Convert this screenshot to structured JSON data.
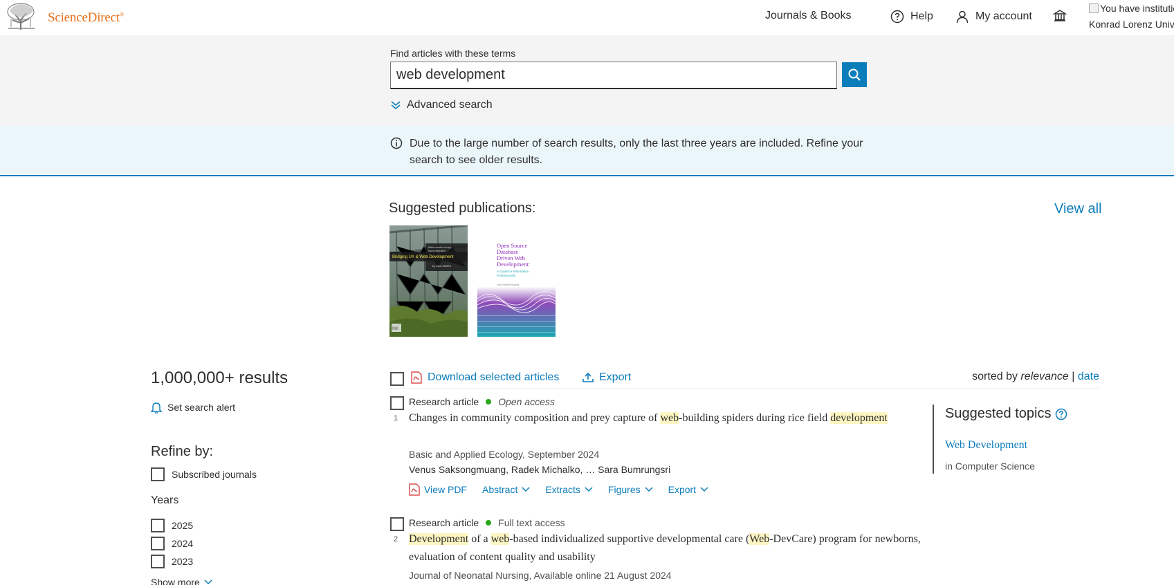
{
  "header": {
    "brand": "ScienceDirect",
    "brand_mark": "®",
    "nav_journals": "Journals & Books",
    "nav_help": "Help",
    "nav_account": "My account",
    "institution_alt": "You have institutional access",
    "institution_name": "Konrad Lorenz University"
  },
  "search": {
    "label": "Find articles with these terms",
    "value": "web development",
    "advanced": "Advanced search"
  },
  "notice": {
    "text": "Due to the large number of search results, only the last three years are included. Refine your search to see older results."
  },
  "suggested_publications": {
    "title": "Suggested publications:",
    "view_all": "View all",
    "books": [
      {
        "title": "Bridging UX & Web Development",
        "line1": "Better results through",
        "line2": "team integration",
        "author": "by Jack Moffett",
        "publisher": "MK"
      },
      {
        "title_lines": [
          "Open Source",
          "Database",
          "Driven Web",
          "Development:"
        ],
        "subtitle_lines": [
          "A Guide for Information",
          "Professionals"
        ],
        "author": "Jason Bartlett Reading"
      }
    ]
  },
  "sidebar": {
    "results_count": "1,000,000+ results",
    "set_alert": "Set search alert",
    "refine_title": "Refine by:",
    "subscribed": "Subscribed journals",
    "years_title": "Years",
    "years": [
      "2025",
      "2024",
      "2023"
    ],
    "show_more": "Show more"
  },
  "toolbar": {
    "download": "Download selected articles",
    "export": "Export",
    "sorted_prefix": "sorted by",
    "sorted_current": "relevance",
    "sorted_sep": "|",
    "sorted_alt": "date"
  },
  "results": [
    {
      "num": "1",
      "type": "Research article",
      "access": "Open access",
      "title_parts": [
        "Changes in community composition and prey capture of ",
        "web",
        "-building spiders during rice field ",
        "development"
      ],
      "source": "Basic and Applied Ecology, September 2024",
      "authors": "Venus Saksongmuang, Radek Michalko, … Sara Bumrungsri",
      "actions": [
        "View PDF",
        "Abstract",
        "Extracts",
        "Figures",
        "Export"
      ]
    },
    {
      "num": "2",
      "type": "Research article",
      "access": "Full text access",
      "title_parts": [
        "Development",
        " of a ",
        "web",
        "-based individualized supportive developmental care (",
        "Web",
        "-DevCare) program for newborns, evaluation of content quality and usability"
      ],
      "source": "Journal of Neonatal Nursing, Available online 21 August 2024"
    }
  ],
  "topics": {
    "title": "Suggested topics",
    "link": "Web Development",
    "sub": "in Computer Science"
  },
  "colors": {
    "brand_orange": "#e9711c",
    "link_blue": "#0c7dbb",
    "highlight": "#fdf6c3",
    "open_access_green": "#29a61b"
  }
}
